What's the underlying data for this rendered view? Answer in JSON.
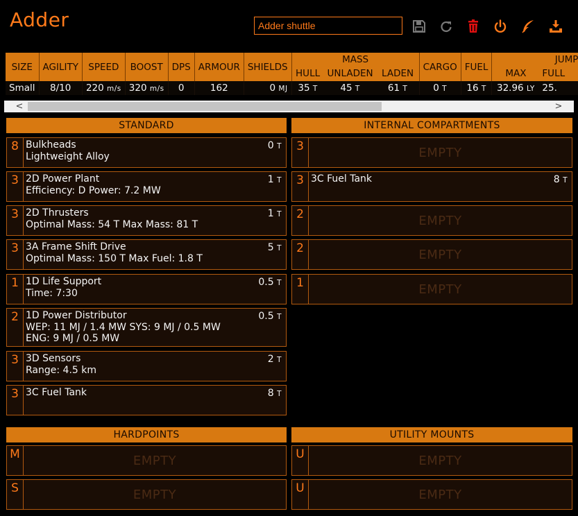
{
  "header": {
    "title": "Adder",
    "ship_name_value": "Adder shuttle",
    "icons": {
      "save": "save-icon",
      "reload": "reload-icon",
      "delete": "trash-icon",
      "power": "power-icon",
      "edit": "feather-icon",
      "export": "download-icon"
    },
    "accent_color": "#ff7a1a",
    "delete_color": "#e01010"
  },
  "stats": {
    "headers": {
      "size": "SIZE",
      "agility": "AGILITY",
      "speed": "SPEED",
      "boost": "BOOST",
      "dps": "DPS",
      "armour": "ARMOUR",
      "shields": "SHIELDS",
      "mass": "MASS",
      "hull": "HULL",
      "unladen": "UNLADEN",
      "laden": "LADEN",
      "cargo": "CARGO",
      "fuel": "FUEL",
      "jump": "JUMP",
      "jump_max": "MAX",
      "jump_full": "FULL"
    },
    "values": {
      "size": "Small",
      "agility": "8/10",
      "speed": "220",
      "speed_unit": "m/s",
      "boost": "320",
      "boost_unit": "m/s",
      "dps": "0",
      "armour": "162",
      "shields": "0",
      "shields_unit": "MJ",
      "hull": "35",
      "hull_unit": "T",
      "unladen": "45",
      "unladen_unit": "T",
      "laden": "61",
      "laden_unit": "T",
      "cargo": "0",
      "cargo_unit": "T",
      "fuel": "16",
      "fuel_unit": "T",
      "jump_max": "32.96",
      "jump_max_unit": "LY",
      "jump_full": "25."
    }
  },
  "scrollbar": {
    "left_arrow": "<",
    "right_arrow": ">"
  },
  "standard": {
    "title": "STANDARD",
    "slots": [
      {
        "cls": "8",
        "name": "Bulkheads",
        "detail": "Lightweight Alloy",
        "mass": "0",
        "unit": "T"
      },
      {
        "cls": "3",
        "name": "2D Power Plant",
        "detail": "Efficiency: D   Power: 7.2 MW",
        "mass": "1",
        "unit": "T"
      },
      {
        "cls": "3",
        "name": "2D Thrusters",
        "detail": "Optimal Mass: 54 T   Max Mass: 81 T",
        "mass": "1",
        "unit": "T"
      },
      {
        "cls": "3",
        "name": "3A Frame Shift Drive",
        "detail": "Optimal Mass: 150 T   Max Fuel: 1.8 T",
        "mass": "5",
        "unit": "T"
      },
      {
        "cls": "1",
        "name": "1D Life Support",
        "detail": "Time: 7:30",
        "mass": "0.5",
        "unit": "T"
      },
      {
        "cls": "2",
        "name": "1D Power Distributor",
        "detail": "WEP: 11 MJ / 1.4 MW   SYS: 9 MJ / 0.5 MW",
        "detail2": "ENG: 9 MJ / 0.5 MW",
        "mass": "0.5",
        "unit": "T"
      },
      {
        "cls": "3",
        "name": "3D Sensors",
        "detail": "Range: 4.5 km",
        "mass": "2",
        "unit": "T"
      },
      {
        "cls": "3",
        "name": "3C Fuel Tank",
        "detail": "",
        "mass": "8",
        "unit": "T"
      }
    ]
  },
  "internal": {
    "title": "INTERNAL COMPARTMENTS",
    "empty_label": "EMPTY",
    "slots": [
      {
        "cls": "3",
        "name": ""
      },
      {
        "cls": "3",
        "name": "3C Fuel Tank",
        "mass": "8",
        "unit": "T"
      },
      {
        "cls": "2",
        "name": ""
      },
      {
        "cls": "2",
        "name": ""
      },
      {
        "cls": "1",
        "name": ""
      }
    ]
  },
  "hardpoints": {
    "title": "HARDPOINTS",
    "empty_label": "EMPTY",
    "slots": [
      {
        "cls": "M"
      },
      {
        "cls": "S"
      }
    ]
  },
  "utility": {
    "title": "UTILITY MOUNTS",
    "empty_label": "EMPTY",
    "slots": [
      {
        "cls": "U"
      },
      {
        "cls": "U"
      }
    ]
  }
}
